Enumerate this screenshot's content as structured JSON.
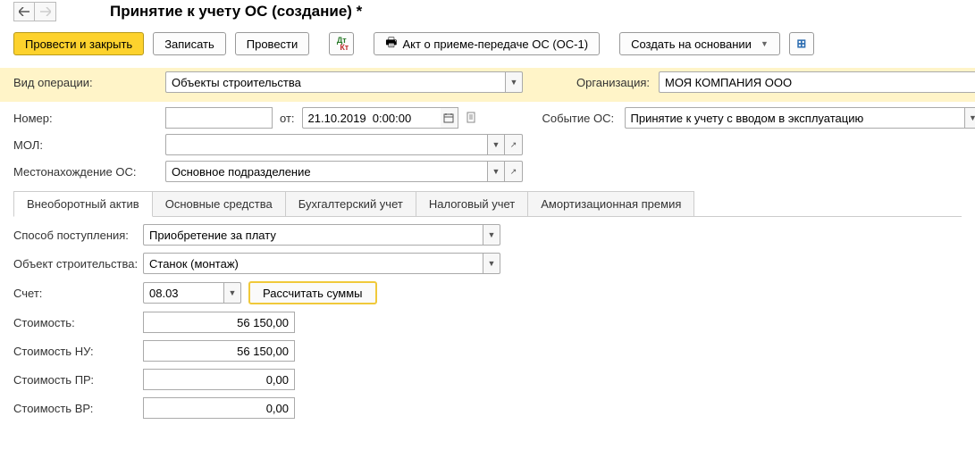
{
  "title": "Принятие к учету ОС (создание) *",
  "toolbar": {
    "post_and_close": "Провести и закрыть",
    "save": "Записать",
    "post": "Провести",
    "act": "Акт о приеме-передаче ОС (ОС-1)",
    "create_based": "Создать на основании"
  },
  "labels": {
    "operation_type": "Вид операции:",
    "organization": "Организация:",
    "number": "Номер:",
    "from": "от:",
    "os_event": "Событие ОС:",
    "mol": "МОЛ:",
    "os_location": "Местонахождение ОС:"
  },
  "values": {
    "operation_type": "Объекты строительства",
    "organization": "МОЯ КОМПАНИЯ ООО",
    "number": "",
    "date": "21.10.2019  0:00:00",
    "os_event": "Принятие к учету с вводом в эксплуатацию",
    "mol": "",
    "os_location": "Основное подразделение"
  },
  "tabs": {
    "noncurrent_asset": "Внеоборотный актив",
    "fixed_assets": "Основные средства",
    "accounting": "Бухгалтерский учет",
    "tax_accounting": "Налоговый учет",
    "depreciation_bonus": "Амортизационная премия"
  },
  "tab1": {
    "receipt_method_label": "Способ поступления:",
    "receipt_method": "Приобретение за плату",
    "construction_object_label": "Объект строительства:",
    "construction_object": "Станок (монтаж)",
    "account_label": "Счет:",
    "account": "08.03",
    "calc_btn": "Рассчитать суммы",
    "cost_label": "Стоимость:",
    "cost": "56 150,00",
    "cost_nu_label": "Стоимость НУ:",
    "cost_nu": "56 150,00",
    "cost_pr_label": "Стоимость ПР:",
    "cost_pr": "0,00",
    "cost_vr_label": "Стоимость ВР:",
    "cost_vr": "0,00"
  }
}
